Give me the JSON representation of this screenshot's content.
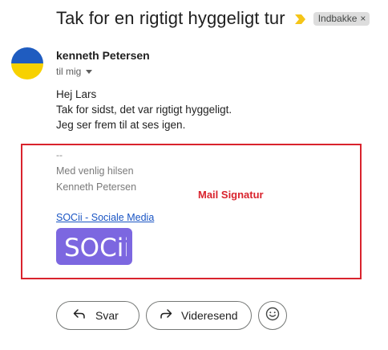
{
  "email": {
    "subject": "Tak for en rigtigt hyggeligt tur",
    "label": "Indbakke",
    "label_close": "×",
    "sender": "kenneth Petersen",
    "recipient": "til mig",
    "body": [
      "Hej Lars",
      "Tak for sidst, det var rigtigt hyggeligt.",
      "Jeg ser frem til at ses igen."
    ]
  },
  "signature": {
    "separator": "--",
    "closing": "Med venlig hilsen",
    "name": "Kenneth Petersen",
    "link_text": "SOCii - Sociale Media",
    "logo_text": "SOCii",
    "annotation": "Mail Signatur"
  },
  "actions": {
    "reply": "Svar",
    "forward": "Videresend"
  },
  "icons": {
    "important": "important-marker-icon",
    "avatar": "flag-avatar",
    "reply": "reply-arrow-icon",
    "forward": "forward-arrow-icon",
    "emoji": "emoji-icon"
  },
  "colors": {
    "annotation": "#d9232d",
    "link": "#1a55c4",
    "logo_bg": "#7c67e0",
    "important": "#f5c518",
    "avatar_top": "#1f5cc0",
    "avatar_bottom": "#f7d100"
  }
}
